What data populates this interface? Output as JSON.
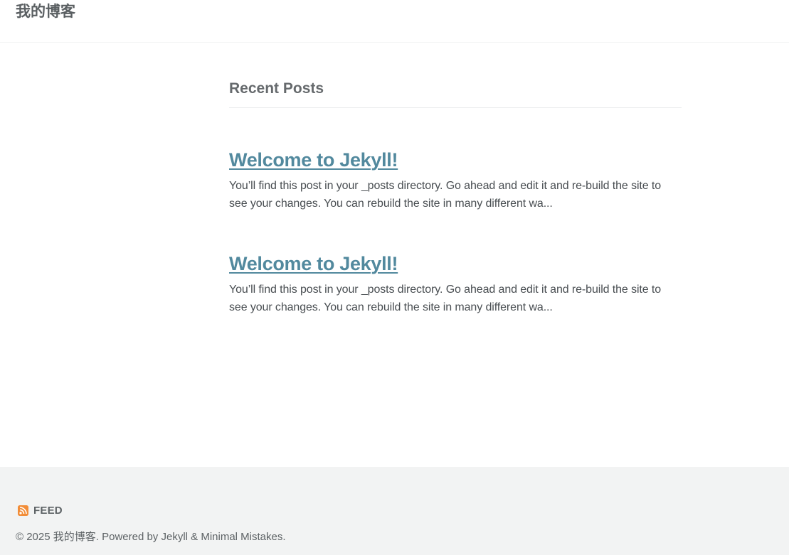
{
  "header": {
    "site_title": "我的博客"
  },
  "main": {
    "section_title": "Recent Posts",
    "posts": [
      {
        "title": "Welcome to Jekyll!",
        "excerpt": "You’ll find this post in your _posts directory. Go ahead and edit it and re-build the site to see your changes. You can rebuild the site in many different wa..."
      },
      {
        "title": "Welcome to Jekyll!",
        "excerpt": "You’ll find this post in your _posts directory. Go ahead and edit it and re-build the site to see your changes. You can rebuild the site in many different wa..."
      }
    ]
  },
  "footer": {
    "feed_label": "FEED",
    "feed_icon": "rss-icon",
    "copyright_prefix": "© 2025 我的博客. Powered by ",
    "jekyll_link": "Jekyll",
    "separator": " & ",
    "theme_link": "Minimal Mistakes",
    "suffix": "."
  },
  "colors": {
    "link": "#52899e",
    "footer_bg": "#f2f3f3",
    "rss": "#f28d38"
  }
}
